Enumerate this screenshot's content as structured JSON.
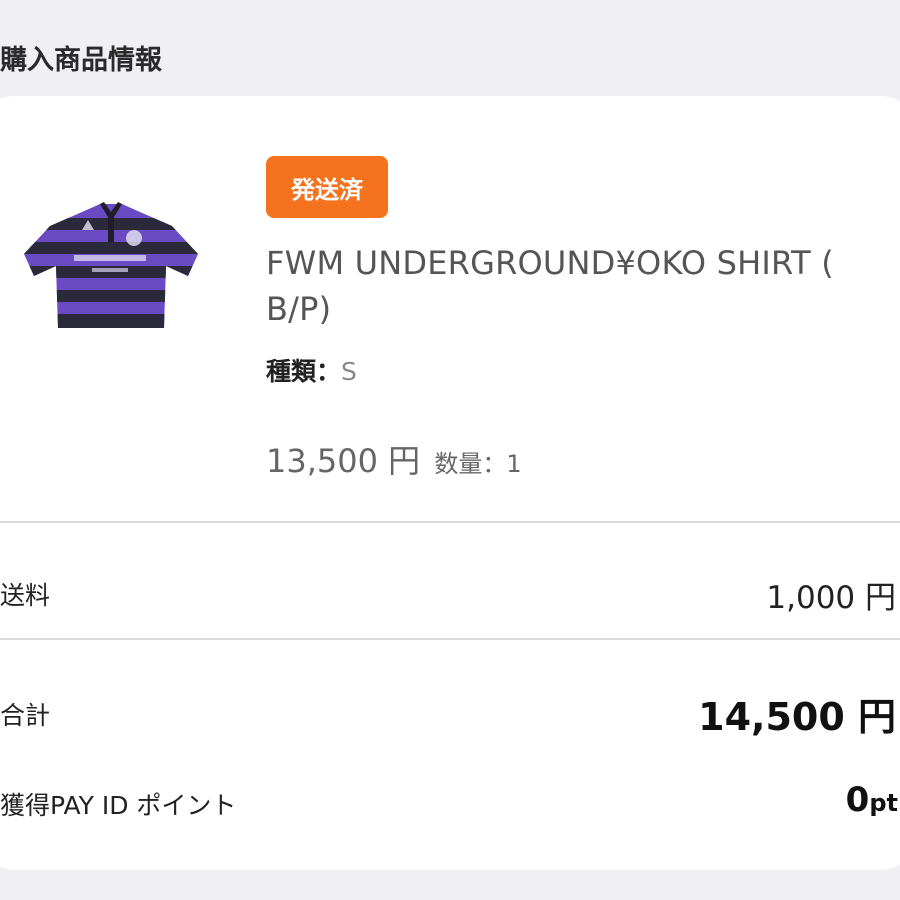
{
  "section": {
    "title": "購入商品情報"
  },
  "order_item": {
    "status_badge": "発送済",
    "status_color": "#f5731e",
    "product_name": "FWM UNDERGROUND¥OKO SHIRT ( B/P)",
    "variant_label": "種類：",
    "variant_value": "S",
    "price": "13,500 円",
    "quantity_label": "数量：1",
    "image": {
      "icon": "striped-polo-shirt-image",
      "stripe_colors": [
        "#6a4bc4",
        "#2b2a3a"
      ]
    }
  },
  "summary": {
    "shipping_label": "送料",
    "shipping_value": "1,000 円",
    "total_label": "合計",
    "total_value": "14,500 円",
    "points_label": "獲得PAY ID ポイント",
    "points_value": "0",
    "points_unit": "pt"
  }
}
